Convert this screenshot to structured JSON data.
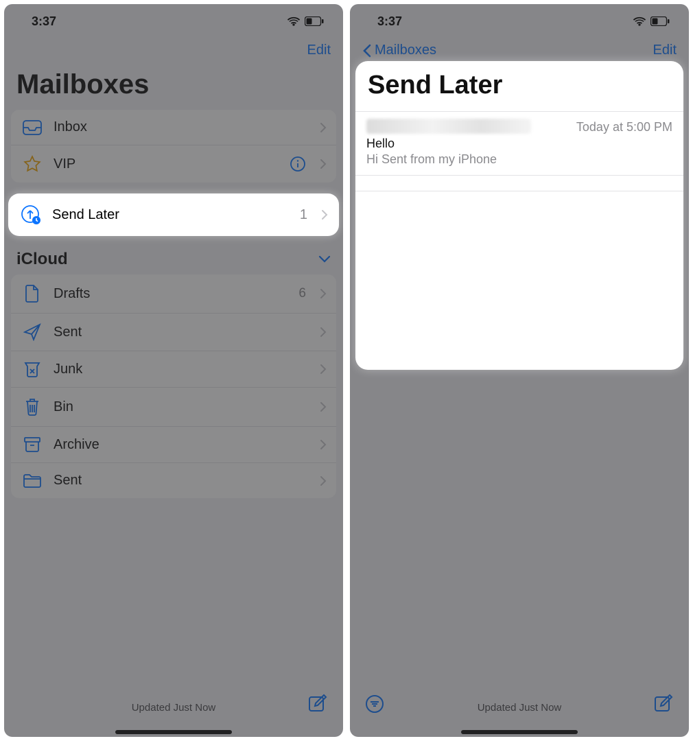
{
  "left": {
    "status": {
      "time": "3:37"
    },
    "nav": {
      "edit": "Edit"
    },
    "title": "Mailboxes",
    "topRows": [
      {
        "label": "Inbox",
        "icon": "inbox",
        "count": "",
        "info": false
      },
      {
        "label": "VIP",
        "icon": "vip",
        "count": "",
        "info": true
      },
      {
        "label": "Send Later",
        "icon": "sendlater",
        "count": "1",
        "highlight": true
      }
    ],
    "sectionTitle": "iCloud",
    "icloudRows": [
      {
        "label": "Drafts",
        "icon": "drafts",
        "count": "6"
      },
      {
        "label": "Sent",
        "icon": "sent",
        "count": ""
      },
      {
        "label": "Junk",
        "icon": "junk",
        "count": ""
      },
      {
        "label": "Bin",
        "icon": "bin",
        "count": ""
      },
      {
        "label": "Archive",
        "icon": "archive",
        "count": ""
      },
      {
        "label": "Sent",
        "icon": "folder",
        "count": ""
      }
    ],
    "footer": {
      "text": "Updated Just Now"
    }
  },
  "right": {
    "status": {
      "time": "3:37"
    },
    "nav": {
      "back": "Mailboxes",
      "edit": "Edit"
    },
    "title": "Send Later",
    "message": {
      "time": "Today at 5:00 PM",
      "subject": "Hello",
      "preview": "Hi Sent from my iPhone"
    },
    "footer": {
      "text": "Updated Just Now"
    }
  }
}
